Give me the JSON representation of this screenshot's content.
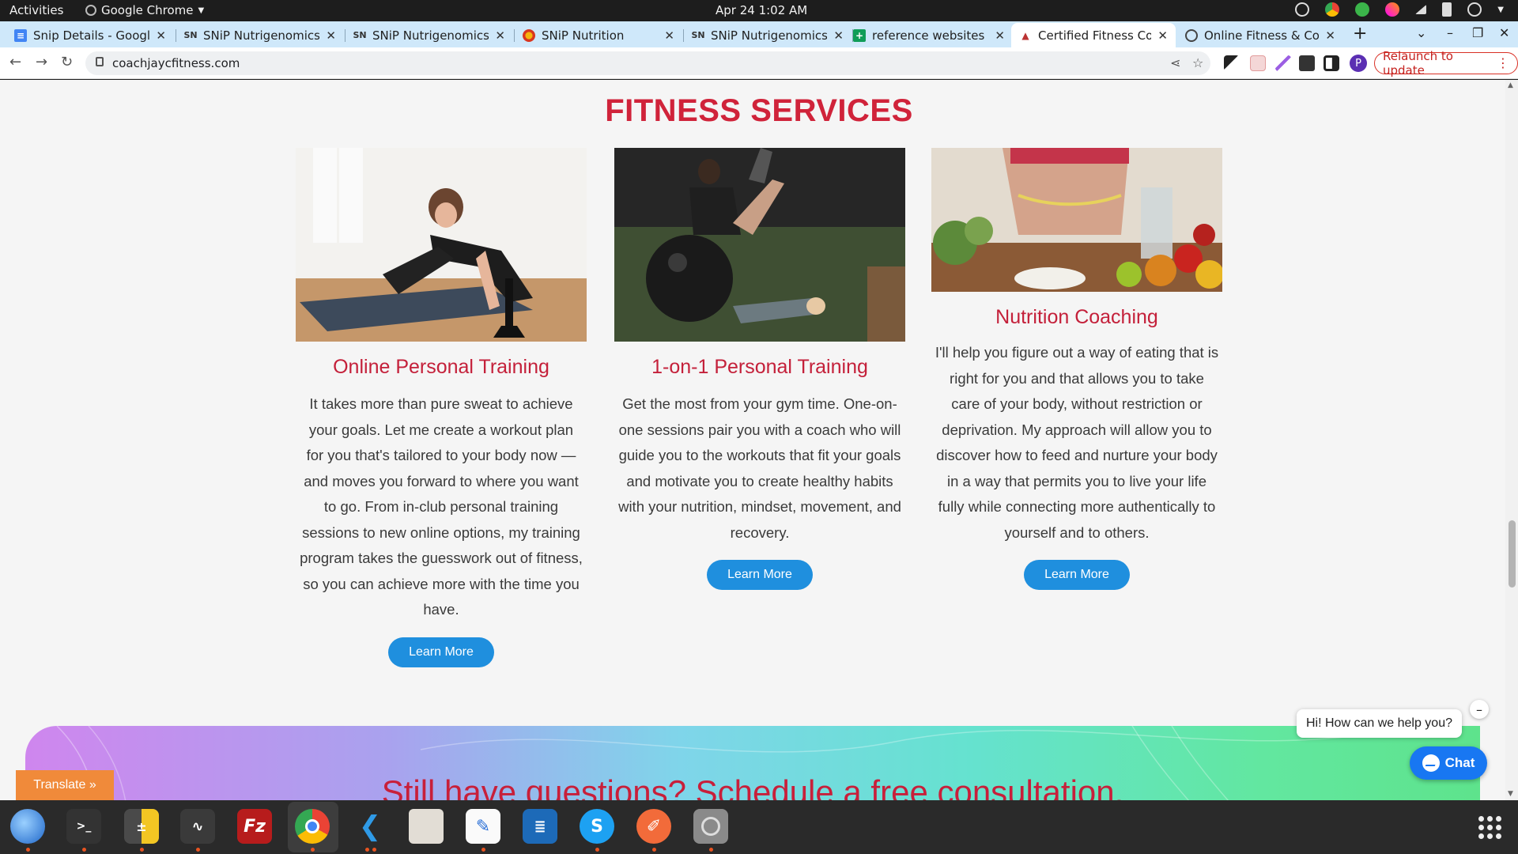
{
  "system": {
    "activities": "Activities",
    "app_name": "Google Chrome",
    "clock": "Apr 24  1:02 AM"
  },
  "tabs": [
    {
      "title": "Snip Details - Google",
      "favicon": "docs-icon",
      "active": false
    },
    {
      "title": "SNiP Nutrigenomics A",
      "favicon": "snip-icon",
      "active": false
    },
    {
      "title": "SNiP Nutrigenomics A",
      "favicon": "snip-icon",
      "active": false
    },
    {
      "title": "SNiP Nutrition",
      "favicon": "snip-nutrition-icon",
      "active": false
    },
    {
      "title": "SNiP Nutrigenomics A",
      "favicon": "snip-icon",
      "active": false
    },
    {
      "title": "reference websites - C",
      "favicon": "sheets-icon",
      "active": false
    },
    {
      "title": "Certified Fitness Coac",
      "favicon": "fitness-icon",
      "active": true
    },
    {
      "title": "Online Fitness & Coac",
      "favicon": "globe-icon",
      "active": false
    }
  ],
  "toolbar": {
    "url": "coachjaycfitness.com",
    "relaunch_label": "Relaunch to update",
    "profile_initial": "P"
  },
  "page": {
    "section_title": "FITNESS SERVICES",
    "cards": [
      {
        "title": "Online Personal Training",
        "body": "It takes more than pure sweat to achieve your goals. Let me create a workout plan for you that's tailored to your body now — and moves you forward to where you want to go. From in-club personal training sessions to new online options, my training program takes the guesswork out of fitness, so you can achieve more with the time you have.",
        "button": "Learn More"
      },
      {
        "title": "1-on-1 Personal Training",
        "body": "Get the most from your gym time. One-on-one sessions pair you with a coach who will guide you to the workouts that fit your goals and motivate you to create healthy habits with your nutrition, mindset, movement, and recovery.",
        "button": "Learn More"
      },
      {
        "title": "Nutrition Coaching",
        "body": "I'll help you figure out a way of eating that is right for you and that allows you to take care of your body, without restriction or deprivation. My approach will allow you to discover how to feed and nurture your body in a way that permits you to live your life fully while connecting more authentically to yourself and to others.",
        "button": "Learn More"
      }
    ],
    "banner_heading": "Still have questions? Schedule a free consultation.",
    "translate_label": "Translate »",
    "chat_greeting": "Hi! How can we help you?",
    "chat_button": "Chat",
    "chat_close": "–"
  },
  "colors": {
    "accent_red": "#d0233a",
    "button_blue": "#1f8fde",
    "messenger_blue": "#1877f2",
    "translate_orange": "#f08a3a"
  },
  "dock": [
    "thunderbird-icon",
    "terminal-icon",
    "calculator-icon",
    "system-monitor-icon",
    "filezilla-icon",
    "chrome-icon",
    "vscode-icon",
    "files-icon",
    "text-editor-icon",
    "writer-icon",
    "skype-icon",
    "postman-icon",
    "disk-icon"
  ]
}
